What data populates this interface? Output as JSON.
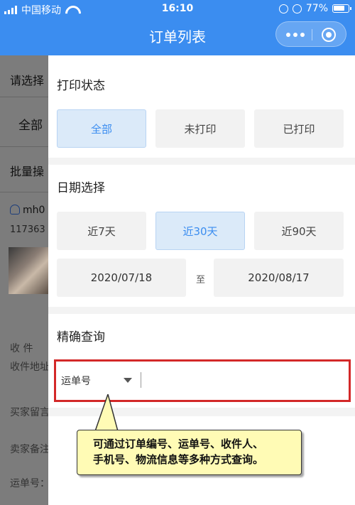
{
  "status_bar": {
    "carrier": "中国移动",
    "time": "16:10",
    "battery": "77%",
    "battery_level": 0.77
  },
  "nav": {
    "title": "订单列表"
  },
  "background_page": {
    "filter_label": "请选择",
    "tab_all": "全部",
    "batch": "批量操",
    "user": "mh0",
    "order_no": "117363",
    "receiver": "收 件 ",
    "address": "收件地址",
    "buyer_msg": "买家留言",
    "seller_note": "卖家备注",
    "tracking": "运单号："
  },
  "print_status": {
    "title": "打印状态",
    "options": [
      "全部",
      "未打印",
      "已打印"
    ],
    "selected": "全部"
  },
  "date_select": {
    "title": "日期选择",
    "options": [
      "近7天",
      "近30天",
      "近90天"
    ],
    "selected": "近30天",
    "start": "2020/07/18",
    "to": "至",
    "end": "2020/08/17"
  },
  "precise_query": {
    "title": "精确查询",
    "field": "运单号",
    "input_value": ""
  },
  "callout": {
    "line1": "可通过订单编号、运单号、收件人、",
    "line2": "手机号、物流信息等多种方式查询。"
  },
  "colors": {
    "accent": "#3b8df0",
    "highlight": "#d32828",
    "callout_bg": "#fffbb5"
  }
}
